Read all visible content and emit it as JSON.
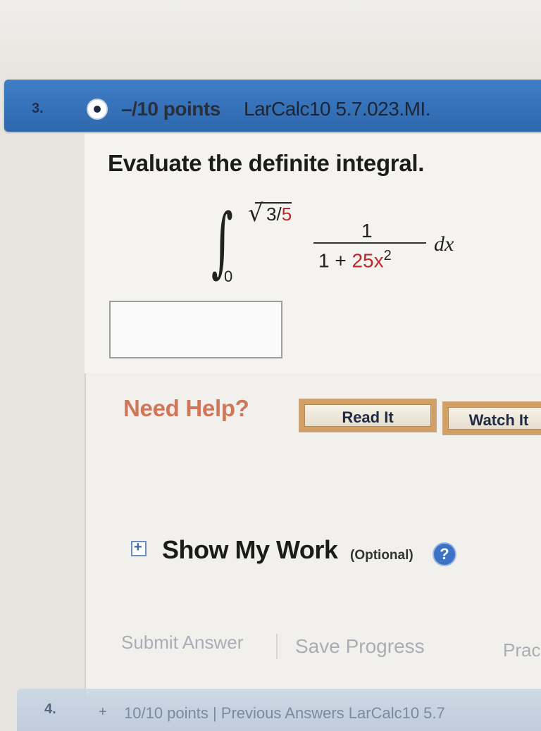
{
  "question": {
    "number": "3.",
    "points": "–/10 points",
    "reference": "LarCalc10 5.7.023.MI."
  },
  "prompt": "Evaluate the definite integral.",
  "integral": {
    "upper_limit_3": "3",
    "upper_limit_slash": "/",
    "upper_limit_5": "5",
    "lower_limit": "0",
    "numerator": "1",
    "denominator_prefix": "1 + ",
    "denominator_coef": "25x",
    "denominator_exp": "2",
    "differential": "dx"
  },
  "answer": {
    "value": ""
  },
  "help": {
    "label": "Need Help?",
    "read_it": "Read It",
    "watch_it": "Watch It"
  },
  "show_work": {
    "title": "Show My Work",
    "optional": "(Optional)",
    "help_icon": "?"
  },
  "actions": {
    "submit": "Submit Answer",
    "save": "Save Progress",
    "practice": "Prac"
  },
  "next_question": {
    "number": "4.",
    "icon": "+",
    "text": "10/10 points  |  Previous Answers  LarCalc10 5.7"
  },
  "colors": {
    "header_blue": "#2e67ad",
    "red_coefficient": "#c0272d",
    "need_help": "#cc6a4a",
    "button_border": "#d3a063"
  }
}
